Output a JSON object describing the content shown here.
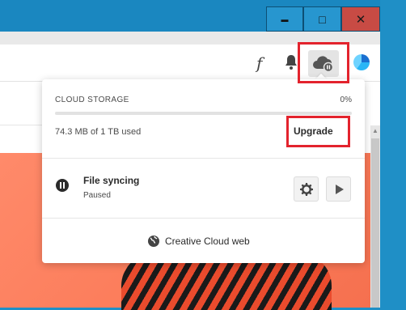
{
  "window": {
    "minimize_glyph": "▬",
    "maximize_glyph": "□",
    "close_glyph": "✕"
  },
  "toolbar": {
    "fonts_glyph": "f",
    "icons": [
      "fonts-icon",
      "bell-icon",
      "cloud-sync-icon",
      "avatar"
    ]
  },
  "popup": {
    "storage_title": "CLOUD STORAGE",
    "storage_percent": "0%",
    "storage_fraction_used": 0,
    "storage_used": "74.3 MB of 1 TB used",
    "upgrade_label": "Upgrade",
    "sync_title": "File syncing",
    "sync_status": "Paused",
    "web_label": "Creative Cloud web"
  },
  "colors": {
    "titlebar": "#1a87c0",
    "close_button": "#c84b44",
    "highlight": "#e3232d",
    "progress": "#2d9bf0",
    "hero": "#fb7b59"
  }
}
